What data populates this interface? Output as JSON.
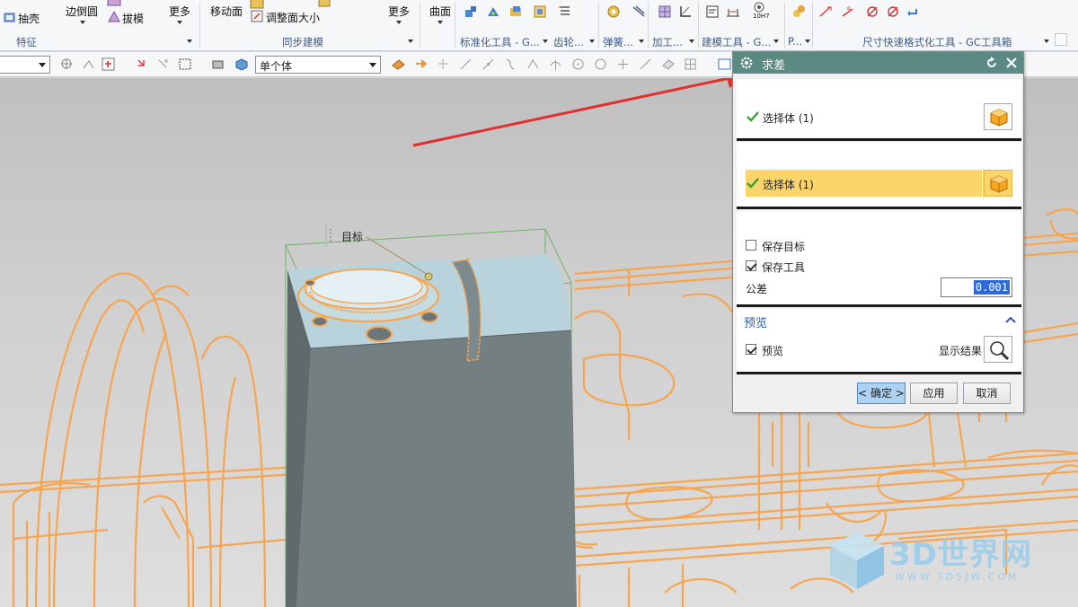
{
  "ribbon": {
    "row1": {
      "shell": "抽壳",
      "edge_blend": "边倒圆",
      "draft": "拔模",
      "more_feature": "更多",
      "move_face": "移动面",
      "resize_face": "调整面大小",
      "more_sync": "更多",
      "surface": "曲面"
    },
    "groups": {
      "feature": "特征",
      "sync_modeling": "同步建模",
      "std_tools": "标准化工具 - G...",
      "gear": "齿轮...",
      "spring": "弹簧...",
      "machining": "加工...",
      "modeling_tools": "建模工具 - G...",
      "p": "P...",
      "dim_format": "尺寸快速格式化工具 - GC工具箱"
    },
    "icon_caption_10h7": "10H7"
  },
  "toolbar2": {
    "filter_combo_value": "",
    "selection_scope": "单个体"
  },
  "viewport": {
    "target_label": "目标"
  },
  "dialog": {
    "title": "求差",
    "target_section": {
      "select_body": "选择体 (1)"
    },
    "tool_section": {
      "select_body": "选择体 (1)"
    },
    "settings": {
      "keep_target": "保存目标",
      "keep_target_checked": false,
      "keep_tool": "保存工具",
      "keep_tool_checked": true,
      "tolerance_label": "公差",
      "tolerance_value": "0.001"
    },
    "preview_section": {
      "header": "预览",
      "preview_label": "预览",
      "preview_checked": true,
      "show_result": "显示结果"
    },
    "buttons": {
      "ok": "< 确定 >",
      "apply": "应用",
      "cancel": "取消"
    }
  },
  "watermark": {
    "brand": "3D世界网",
    "url": "WWW.3DSJW.COM"
  },
  "colors": {
    "dialog_title_bg": "#5a8a82",
    "highlight_row": "#fbd56a",
    "wire_orange": "#f7a550",
    "body_grey": "#727e80",
    "arrow_red": "#e2302e"
  }
}
